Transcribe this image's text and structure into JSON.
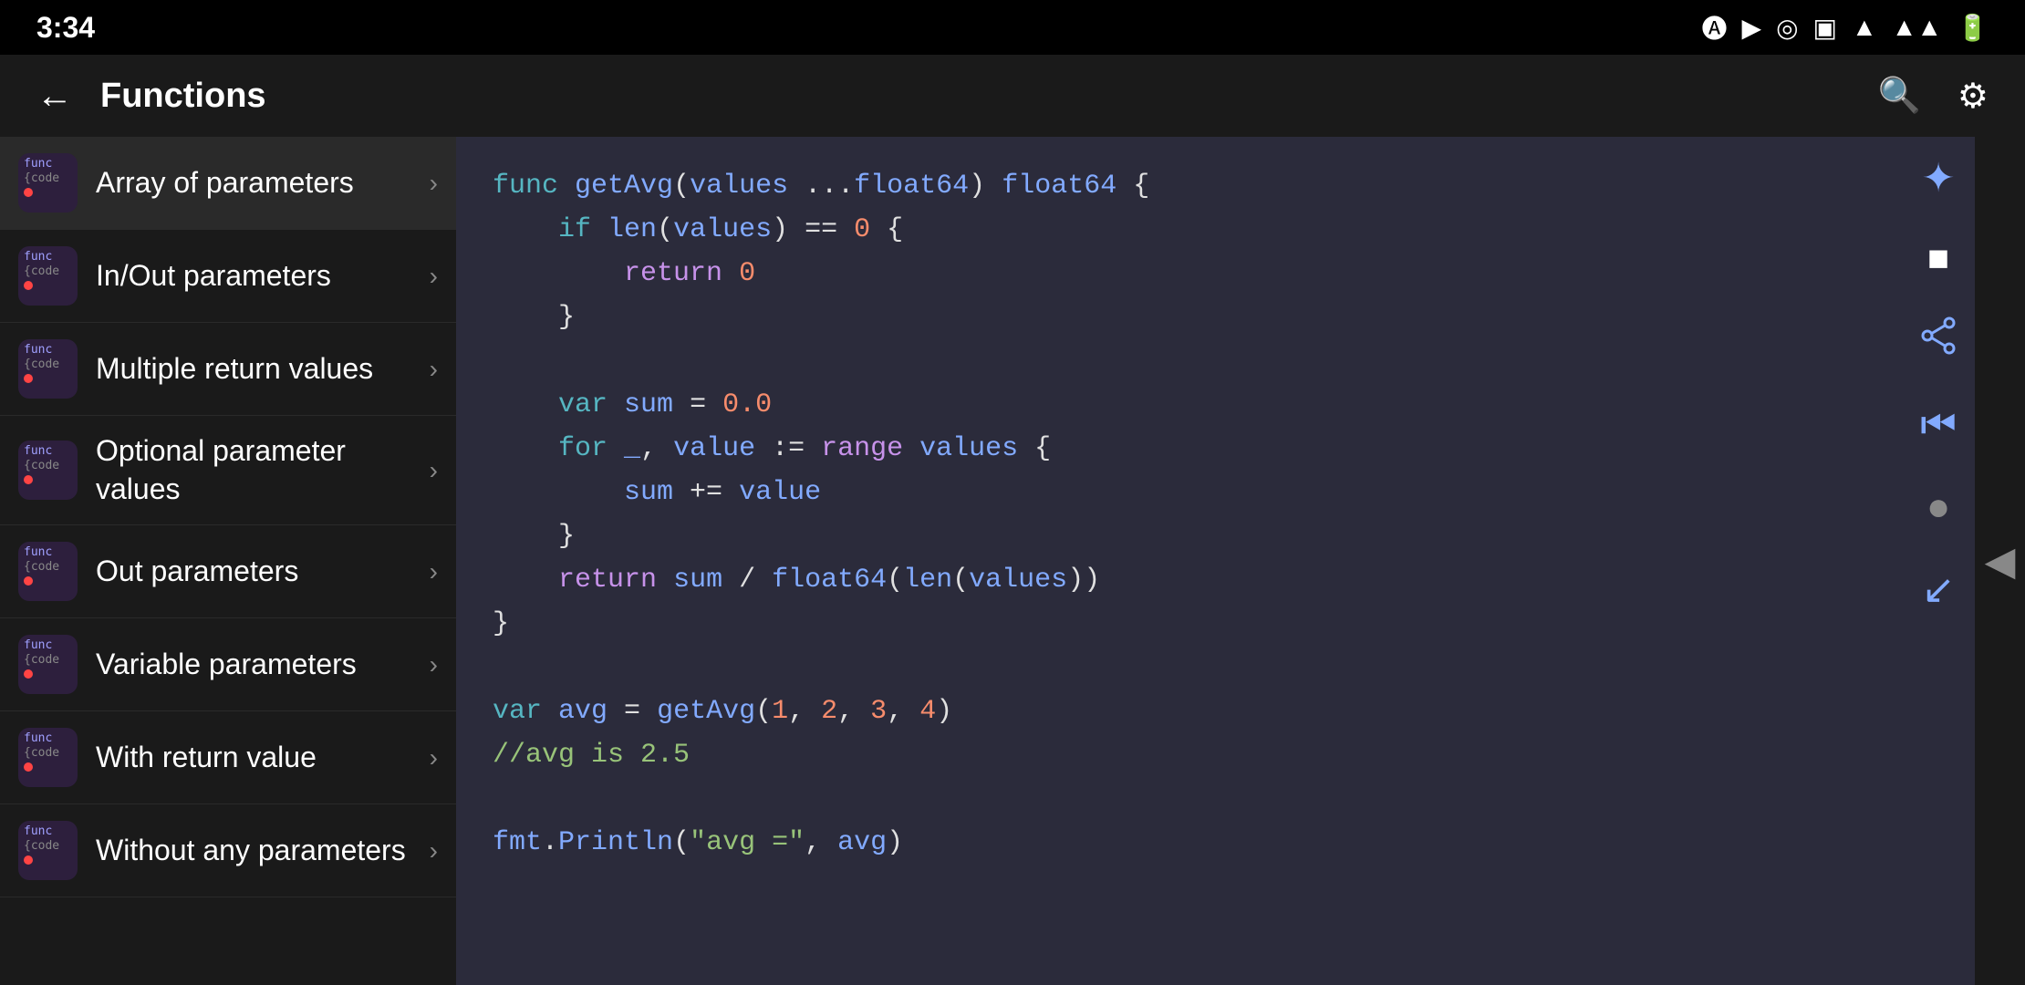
{
  "statusBar": {
    "time": "3:34",
    "icons": [
      "A",
      "▶",
      "◎",
      "▣"
    ]
  },
  "navBar": {
    "backLabel": "←",
    "title": "Functions",
    "searchLabel": "🔍",
    "settingsLabel": "⚙"
  },
  "sidebar": {
    "items": [
      {
        "id": "array-of-parameters",
        "label": "Array of parameters",
        "active": true
      },
      {
        "id": "in-out-parameters",
        "label": "In/Out parameters",
        "active": false
      },
      {
        "id": "multiple-return-values",
        "label": "Multiple return values",
        "active": false
      },
      {
        "id": "optional-parameter-values",
        "label": "Optional parameter values",
        "active": false
      },
      {
        "id": "out-parameters",
        "label": "Out parameters",
        "active": false
      },
      {
        "id": "variable-parameters",
        "label": "Variable parameters",
        "active": false
      },
      {
        "id": "with-return-value",
        "label": "With return value",
        "active": false
      },
      {
        "id": "without-any-parameters",
        "label": "Without any parameters",
        "active": false
      }
    ]
  },
  "actionBar": {
    "icons": [
      {
        "name": "star-icon",
        "symbol": "✦",
        "color": "#82aaff"
      },
      {
        "name": "white-square-icon",
        "symbol": "■",
        "color": "#fff"
      },
      {
        "name": "share-icon",
        "symbol": "⤴",
        "color": "#82aaff"
      },
      {
        "name": "first-page-icon",
        "symbol": "⏮",
        "color": "#82aaff"
      },
      {
        "name": "circle-icon",
        "symbol": "●",
        "color": "#888"
      },
      {
        "name": "arrow-down-icon",
        "symbol": "↙",
        "color": "#82aaff"
      }
    ]
  },
  "playback": {
    "icon": "◀"
  },
  "codeContent": {
    "lines": [
      "func getAvg(values ...float64) float64 {",
      "    if len(values) == 0 {",
      "        return 0",
      "    }",
      "",
      "    var sum = 0.0",
      "    for _, value := range values {",
      "        sum += value",
      "    }",
      "    return sum / float64(len(values))",
      "}",
      "",
      "var avg = getAvg(1, 2, 3, 4)",
      "//avg is 2.5",
      "",
      "fmt.Println(\"avg =\", avg)"
    ]
  }
}
